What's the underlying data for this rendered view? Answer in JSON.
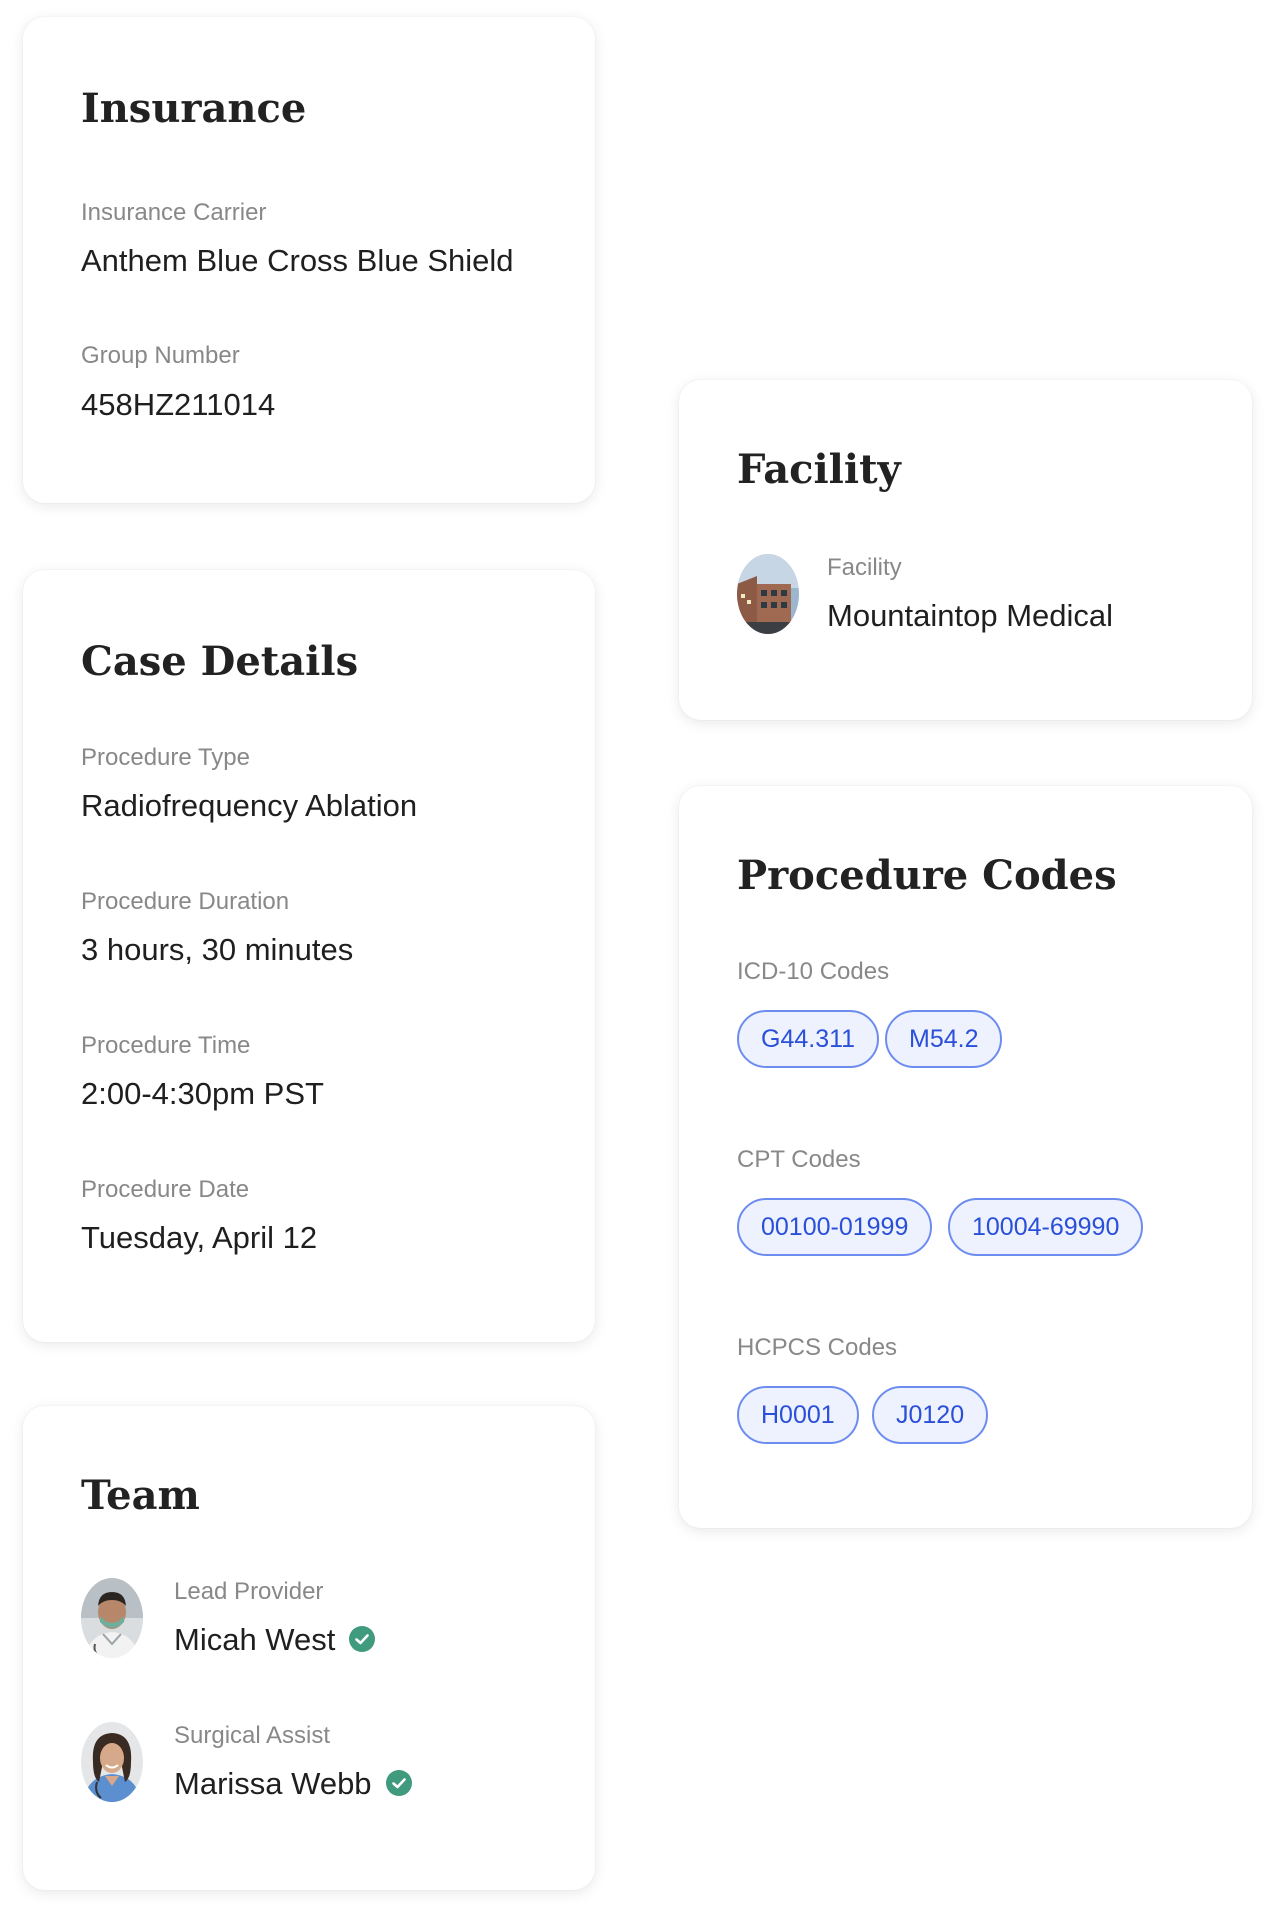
{
  "insurance": {
    "title": "Insurance",
    "carrier_label": "Insurance Carrier",
    "carrier_value": "Anthem Blue Cross Blue Shield",
    "group_label": "Group Number",
    "group_value": "458HZ211014"
  },
  "case_details": {
    "title": "Case Details",
    "fields": [
      {
        "label": "Procedure Type",
        "value": "Radiofrequency Ablation"
      },
      {
        "label": "Procedure Duration",
        "value": "3 hours, 30 minutes"
      },
      {
        "label": "Procedure Time",
        "value": "2:00-4:30pm PST"
      },
      {
        "label": "Procedure Date",
        "value": "Tuesday, April 12"
      }
    ]
  },
  "team": {
    "title": "Team",
    "members": [
      {
        "role": "Lead Provider",
        "name": "Micah West",
        "verified": true,
        "avatar_icon": "provider-avatar"
      },
      {
        "role": "Surgical Assist",
        "name": "Marissa Webb",
        "verified": true,
        "avatar_icon": "assistant-avatar"
      }
    ]
  },
  "facility": {
    "title": "Facility",
    "label": "Facility",
    "value": "Mountaintop Medical",
    "image_icon": "facility-building-photo"
  },
  "procedure_codes": {
    "title": "Procedure Codes",
    "groups": [
      {
        "label": "ICD-10 Codes",
        "codes": [
          "G44.311",
          "M54.2"
        ]
      },
      {
        "label": "CPT Codes",
        "codes": [
          "00100-01999",
          "10004-69990"
        ]
      },
      {
        "label": "HCPCS Codes",
        "codes": [
          "H0001",
          "J0120"
        ]
      }
    ]
  },
  "colors": {
    "chip_border": "#6d8cf0",
    "chip_bg": "#eef2ff",
    "chip_text": "#2a4fd8",
    "verified_green": "#3f9a7e",
    "label_gray": "#888888"
  }
}
